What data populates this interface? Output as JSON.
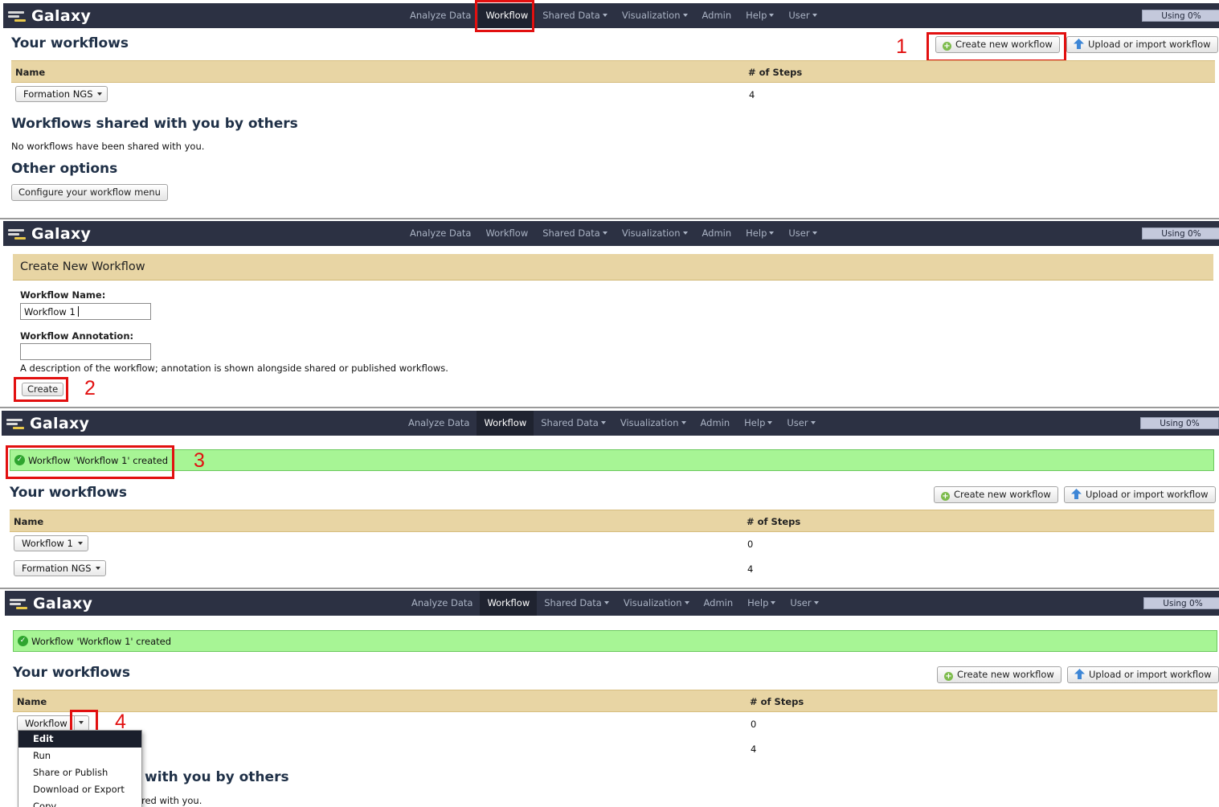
{
  "brand": {
    "title": "Galaxy"
  },
  "nav": [
    {
      "label": "Analyze Data",
      "dropdown": false
    },
    {
      "label": "Workflow",
      "dropdown": false
    },
    {
      "label": "Shared Data",
      "dropdown": true
    },
    {
      "label": "Visualization",
      "dropdown": true
    },
    {
      "label": "Admin",
      "dropdown": false
    },
    {
      "label": "Help",
      "dropdown": true
    },
    {
      "label": "User",
      "dropdown": true
    }
  ],
  "usage": "Using 0%",
  "colors": {
    "masthead": "#2c3143",
    "table_header": "#e8d5a4",
    "success": "#a7f595",
    "highlight_box": "#e21010"
  },
  "icons": [
    "galaxy-logo-icon",
    "plus-circle-icon",
    "upload-arrow-icon",
    "check-circle-icon",
    "caret-down-icon"
  ],
  "steps": [
    "1",
    "2",
    "3",
    "4"
  ],
  "workflows_page": {
    "title": "Your workflows",
    "create_btn": "Create new workflow",
    "upload_btn": "Upload or import workflow",
    "col_name": "Name",
    "col_steps": "# of Steps",
    "shared_title": "Workflows shared with you by others",
    "shared_empty": "No workflows have been shared with you.",
    "other_title": "Other options",
    "configure_btn": "Configure your workflow menu"
  },
  "panel1_rows": [
    {
      "name": "Formation NGS",
      "steps": "4"
    }
  ],
  "create_form": {
    "title": "Create New Workflow",
    "name_label": "Workflow Name:",
    "name_value": "Workflow 1",
    "annotation_label": "Workflow Annotation:",
    "annotation_value": "",
    "help": "A description of the workflow; annotation is shown alongside shared or published workflows.",
    "submit": "Create"
  },
  "alert": {
    "message": "Workflow 'Workflow 1' created"
  },
  "panel3_rows": [
    {
      "name": "Workflow 1",
      "steps": "0"
    },
    {
      "name": "Formation NGS",
      "steps": "4"
    }
  ],
  "panel4": {
    "row1_name": "Workflow",
    "row1_steps": "0",
    "row2_steps": "4",
    "shared_partial": "with you by others",
    "shared_empty_partial": "red with you.",
    "menu": [
      "Edit",
      "Run",
      "Share or Publish",
      "Download or Export",
      "Copy"
    ]
  }
}
